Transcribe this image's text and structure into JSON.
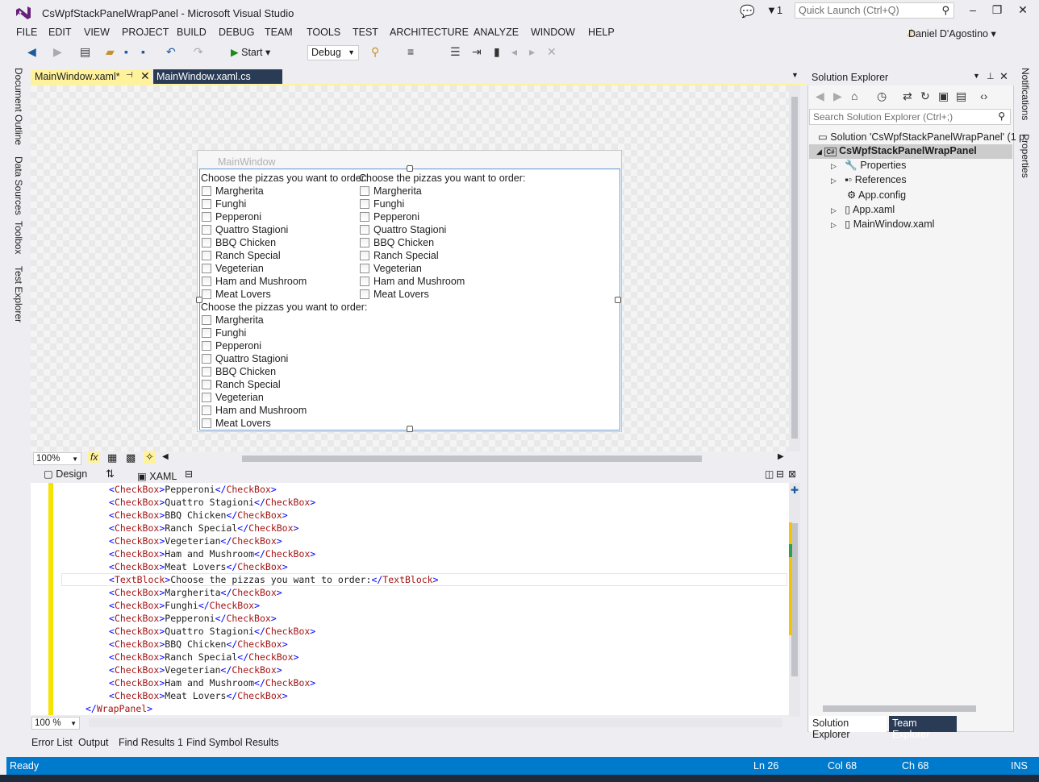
{
  "window": {
    "title": "CsWpfStackPanelWrapPanel - Microsoft Visual Studio",
    "quick_launch_placeholder": "Quick Launch (Ctrl+Q)",
    "notification_count": "1",
    "user": "Daniel D'Agostino"
  },
  "menu": [
    "FILE",
    "EDIT",
    "VIEW",
    "PROJECT",
    "BUILD",
    "DEBUG",
    "TEAM",
    "TOOLS",
    "TEST",
    "ARCHITECTURE",
    "ANALYZE",
    "WINDOW",
    "HELP"
  ],
  "toolbar": {
    "start_label": "Start",
    "config": "Debug"
  },
  "left_tabs": [
    "Document Outline",
    "Data Sources",
    "Toolbox",
    "Test Explorer"
  ],
  "right_tabs": [
    "Notifications",
    "Properties"
  ],
  "doc_tabs": [
    "MainWindow.xaml*",
    "MainWindow.xaml.cs"
  ],
  "designer": {
    "window_title": "MainWindow",
    "header": "Choose the pizzas you want to order:",
    "pizzas": [
      "Margherita",
      "Funghi",
      "Pepperoni",
      "Quattro Stagioni",
      "BBQ Chicken",
      "Ranch Special",
      "Vegeterian",
      "Ham and Mushroom",
      "Meat Lovers"
    ],
    "zoom": "100%"
  },
  "split": {
    "design_label": "Design",
    "xaml_label": "XAML"
  },
  "code": {
    "lines": [
      {
        "type": "cb",
        "text": "Pepperoni"
      },
      {
        "type": "cb",
        "text": "Quattro Stagioni"
      },
      {
        "type": "cb",
        "text": "BBQ Chicken"
      },
      {
        "type": "cb",
        "text": "Ranch Special"
      },
      {
        "type": "cb",
        "text": "Vegeterian"
      },
      {
        "type": "cb",
        "text": "Ham and Mushroom"
      },
      {
        "type": "cb",
        "text": "Meat Lovers"
      },
      {
        "type": "tb",
        "text": "Choose the pizzas you want to order:"
      },
      {
        "type": "cb",
        "text": "Margherita"
      },
      {
        "type": "cb",
        "text": "Funghi"
      },
      {
        "type": "cb",
        "text": "Pepperoni"
      },
      {
        "type": "cb",
        "text": "Quattro Stagioni"
      },
      {
        "type": "cb",
        "text": "BBQ Chicken"
      },
      {
        "type": "cb",
        "text": "Ranch Special"
      },
      {
        "type": "cb",
        "text": "Vegeterian"
      },
      {
        "type": "cb",
        "text": "Ham and Mushroom"
      },
      {
        "type": "cb",
        "text": "Meat Lovers"
      }
    ],
    "closing": "</WrapPanel>",
    "zoom": "100 %"
  },
  "bottom_tabs": [
    "Error List",
    "Output",
    "Find Results 1",
    "Find Symbol Results"
  ],
  "status": {
    "ready": "Ready",
    "ln": "Ln 26",
    "col": "Col 68",
    "ch": "Ch 68",
    "mode": "INS"
  },
  "solution_explorer": {
    "title": "Solution Explorer",
    "search_placeholder": "Search Solution Explorer (Ctrl+;)",
    "solution": "Solution 'CsWpfStackPanelWrapPanel' (1 p",
    "project": "CsWpfStackPanelWrapPanel",
    "items": [
      "Properties",
      "References",
      "App.config",
      "App.xaml",
      "MainWindow.xaml"
    ],
    "tabs": [
      "Solution Explorer",
      "Team Explorer"
    ]
  }
}
